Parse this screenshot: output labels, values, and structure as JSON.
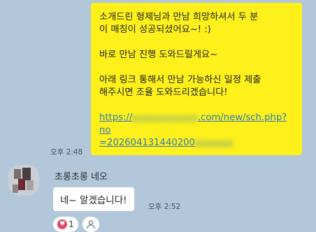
{
  "sent_message": {
    "line1": "소개드린 형제님과 만남 희망하셔서 두 분",
    "line2": "이 매칭이 성공되셨어요~! :)",
    "line3": "바로 만남 진행 도와드릴게요~",
    "line4": "아래 링크 통해서 만남 가능하신 일정 제출",
    "line5": "해주시면 조율 도와드리겠습니다!",
    "link_line1_prefix": "https://",
    "link_line1_suffix": ".com/new/sch.php?no",
    "link_line2_prefix": "=202604131440200",
    "time": "오후 2:48"
  },
  "received_message": {
    "sender_name": "초롱초롱 네오",
    "text": "네~ 알겠습니다!",
    "time": "오후 2:52"
  },
  "reactions": {
    "heart_count": "1",
    "heart_icon": "heart-icon",
    "add_icon": "person-add-reaction-icon"
  },
  "colors": {
    "background": "#b2c7da",
    "sent_bubble": "#fef01b",
    "received_bubble": "#ffffff",
    "link": "#2e7bb8",
    "heart": "#e84867"
  }
}
